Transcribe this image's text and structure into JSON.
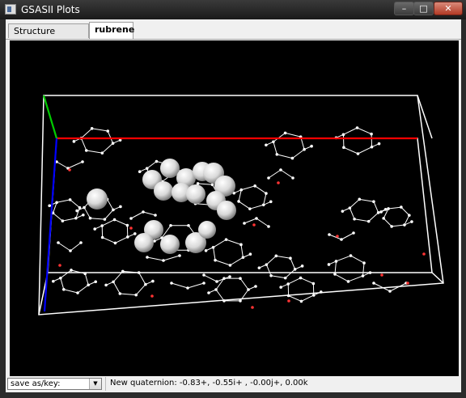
{
  "window": {
    "title": "GSASII Plots",
    "minimize_glyph": "–",
    "maximize_glyph": "□",
    "close_glyph": "✕"
  },
  "tabs": [
    {
      "label": "Structure Factors",
      "active": false
    },
    {
      "label": "rubrene",
      "active": true
    }
  ],
  "plot": {
    "background": "#000000",
    "box_color": "#ffffff",
    "a_axis_color": "#ff0000",
    "b_axis_color": "#00cc00",
    "c_axis_color": "#0000ff",
    "atom_color": "#ffffff",
    "oxygen_like_color": "#ff3333",
    "icon_sphere": "sphere-atoms"
  },
  "statusbar": {
    "save_combo": "save as/key:",
    "message": "New quaternion: -0.83+, -0.55i+ , -0.00j+, 0.00k"
  }
}
